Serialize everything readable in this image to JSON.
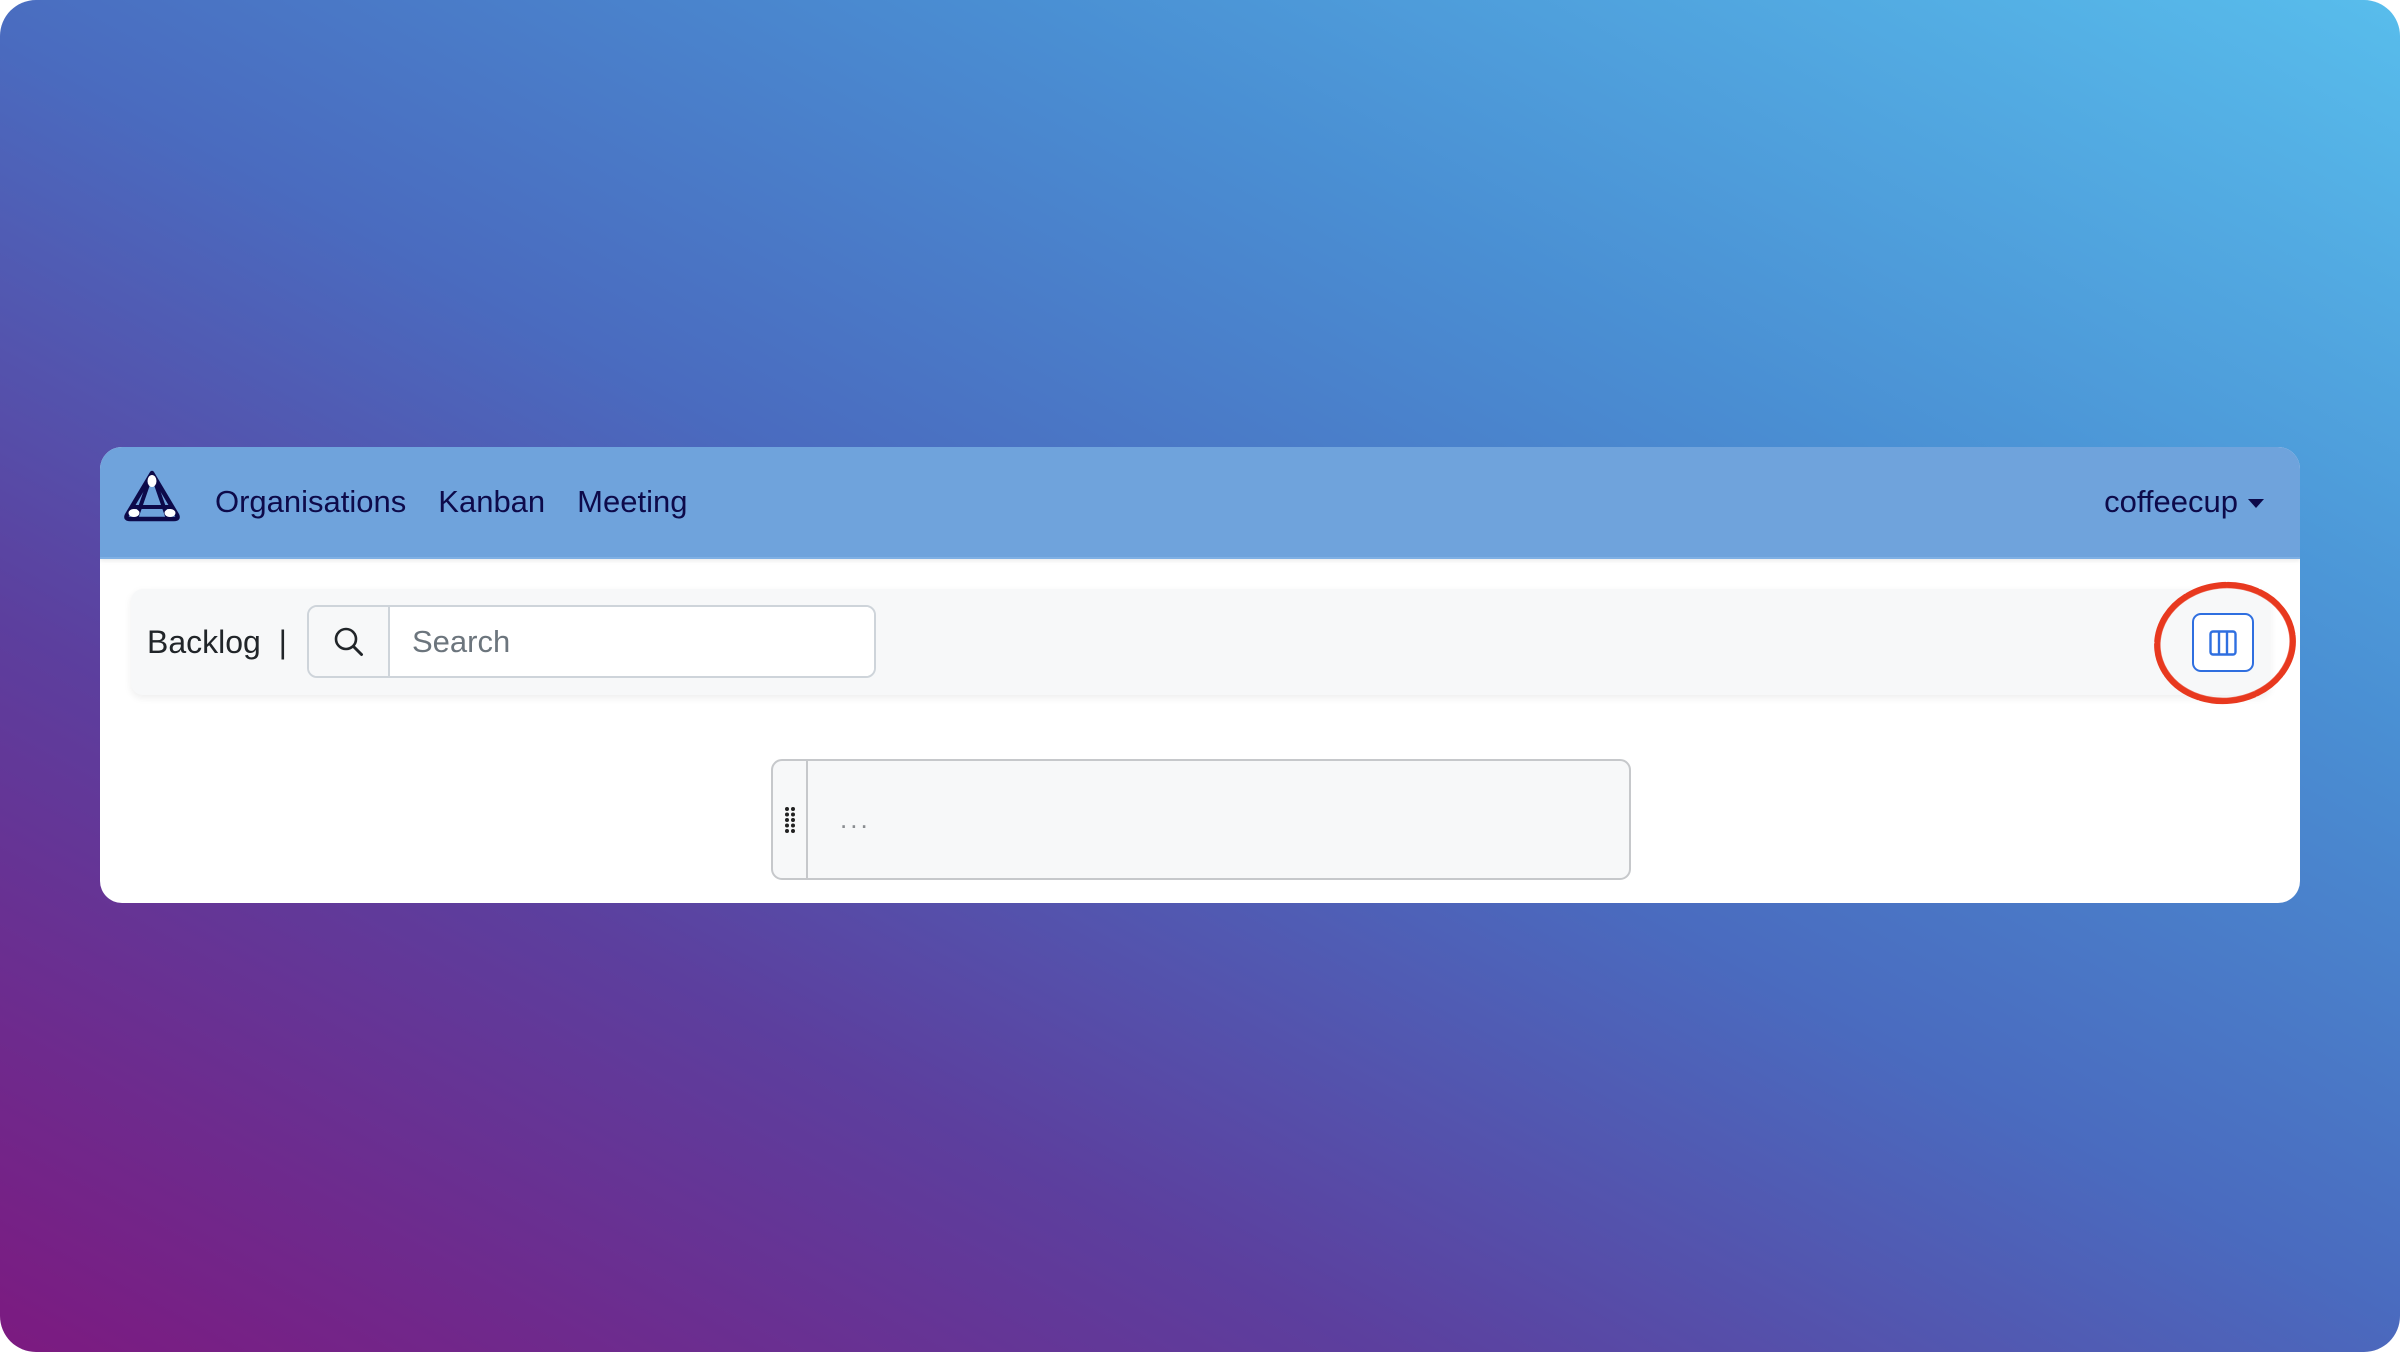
{
  "navbar": {
    "logo_icon": "triangle-a-logo-icon",
    "links": [
      {
        "label": "Organisations"
      },
      {
        "label": "Kanban"
      },
      {
        "label": "Meeting"
      }
    ],
    "user": {
      "name": "coffeecup",
      "caret_icon": "caret-down-icon"
    }
  },
  "toolbar": {
    "title": "Backlog  |",
    "search": {
      "icon": "search-icon",
      "value": "",
      "placeholder": "Search"
    },
    "layout_button": {
      "icon": "layout-three-columns-icon",
      "annotated": true,
      "annotation_color": "#e8391f"
    }
  },
  "backlog": {
    "items": [
      {
        "handle_icon": "grip-vertical-icon",
        "text": "..."
      }
    ]
  },
  "colors": {
    "navbar_bg": "#6fa3dc",
    "nav_text": "#0d0a4a",
    "accent": "#2f6fe0",
    "backdrop_start": "#7c1a80",
    "backdrop_end": "#58bdec"
  }
}
